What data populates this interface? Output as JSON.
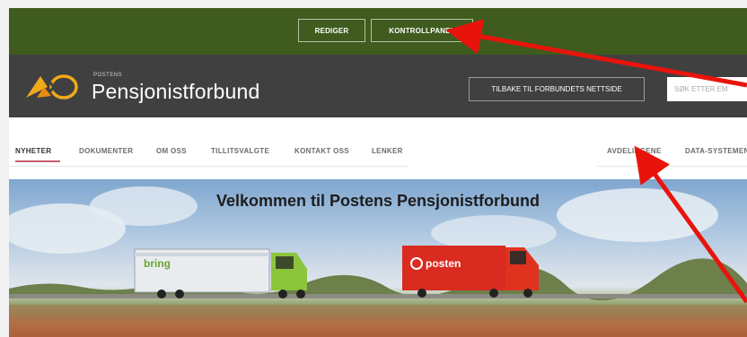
{
  "admin_bar": {
    "edit_label": "REDIGER",
    "panel_label": "KONTROLLPANEL"
  },
  "header": {
    "brand_small": "POSTENS",
    "brand_big": "Pensjonistforbund",
    "back_label": "TILBAKE TIL FORBUNDETS NETTSIDE",
    "search_placeholder": "SØK ETTER EM"
  },
  "nav": {
    "items": [
      {
        "label": "NYHETER"
      },
      {
        "label": "DOKUMENTER"
      },
      {
        "label": "OM OSS"
      },
      {
        "label": "TILLITSVALGTE"
      },
      {
        "label": "KONTAKT OSS"
      },
      {
        "label": "LENKER"
      },
      {
        "label": "AVDELINGENE"
      },
      {
        "label": "DATA-SYSTEMEN"
      }
    ],
    "active": "NYHETER"
  },
  "hero": {
    "title": "Velkommen til Postens Pensjonistforbund",
    "truck1_text": "bring",
    "truck2_text": "posten"
  },
  "colors": {
    "admin_bg": "#3f5b1e",
    "header_bg": "#404040",
    "active_underline": "#c85c6a",
    "arrow": "#e8140c"
  }
}
